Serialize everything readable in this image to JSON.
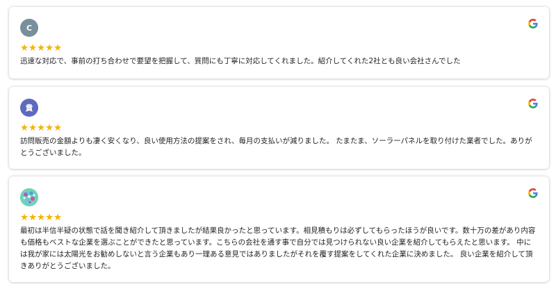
{
  "brand": {
    "star_color": "#f4b400"
  },
  "reviews": [
    {
      "avatar_initial": "C",
      "avatar_color": "#78909c",
      "rating": 5,
      "source_icon": "google-icon",
      "text": "迅速な対応で、事前の打ち合わせで要望を把握して、質問にも丁寧に対応してくれました。紹介してくれた2社とも良い会社さんでした"
    },
    {
      "avatar_initial": "貴",
      "avatar_color": "#5c6bc0",
      "rating": 5,
      "source_icon": "google-icon",
      "text": "訪問販売の金額よりも凄く安くなり、良い使用方法の提案をされ、毎月の支払いが減りました。 たまたま、ソーラーパネルを取り付けた業者でした。ありがとうございました。"
    },
    {
      "avatar_initial": "",
      "avatar_color": "#5ec5a8",
      "rating": 5,
      "source_icon": "google-icon",
      "text": "最初は半信半疑の状態で話を聞き紹介して頂きましたが結果良かったと思っています。相見積もりは必ずしてもらったほうが良いです。数十万の差があり内容も価格もベストな企業を選ぶことができたと思っています。こちらの会社を通す事で自分では見つけられない良い企業を紹介してもらえたと思います。 中には我が家には太陽光をお勧めしないと言う企業もあり一理ある意見ではありましたがそれを覆す提案をしてくれた企業に決めました。 良い企業を紹介して頂きありがとうございました。"
    }
  ]
}
